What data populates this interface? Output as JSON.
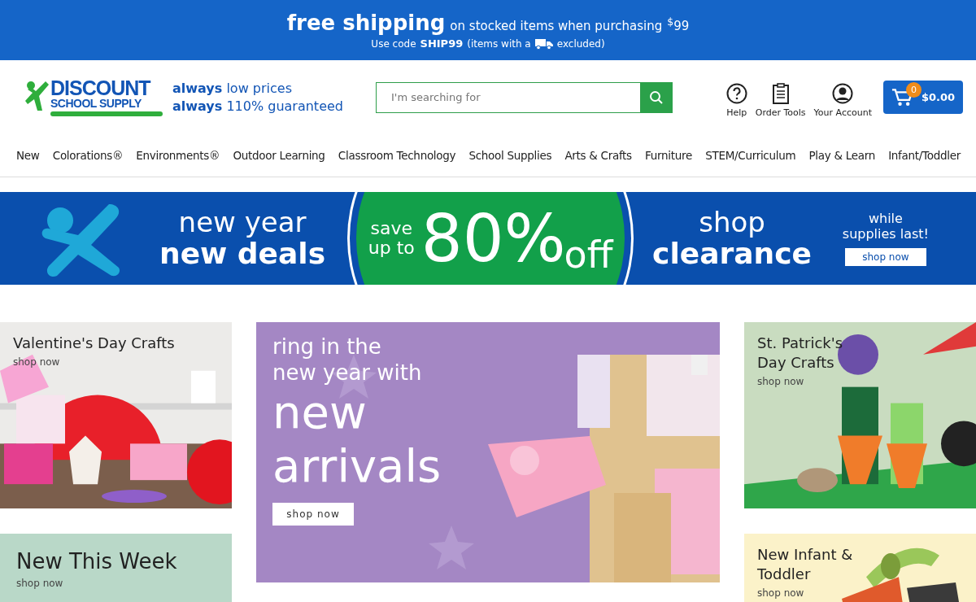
{
  "promo_bar": {
    "headline": "free shipping",
    "detail": "on stocked items when purchasing",
    "amount": "$^{$}$99",
    "code_prefix": "Use code",
    "code": "SHIP99",
    "note_before": "(items with a",
    "note_after": "excluded)"
  },
  "header": {
    "logo_top": "DISCOUNT",
    "logo_bottom": "SCHOOL SUPPLY",
    "tagline_1": "**always** low prices",
    "tagline_2": "**always** 110% guaranteed",
    "search": {
      "placeholder": "I'm searching for"
    },
    "tools": [
      {
        "kind": "help",
        "label": "Help"
      },
      {
        "kind": "order",
        "label": "Order Tools"
      },
      {
        "kind": "account",
        "label": "Your Account"
      }
    ],
    "cart": {
      "count": "0",
      "total": "$0.00"
    }
  },
  "nav": [
    "New",
    "Colorations®",
    "Environments®",
    "Outdoor Learning",
    "Classroom Technology",
    "School Supplies",
    "Arts & Crafts",
    "Furniture",
    "STEM/Curriculum",
    "Play & Learn",
    "Infant/Toddler"
  ],
  "hero": {
    "line_1": "new year",
    "line_2": "new deals",
    "save_1": "save",
    "save_2": "up to",
    "percent": "80%",
    "off": "off",
    "shop_1": "shop",
    "shop_2": "clearance",
    "note": "while supplies last!",
    "button": "shop now"
  },
  "tiles": [
    {
      "title": "Valentine's Day Crafts",
      "link": "shop now",
      "kind": "valentine"
    },
    {
      "title": "New This Week",
      "link": "shop now",
      "kind": "plain"
    },
    {
      "title_1": "ring in the",
      "title_2": "new year with",
      "big_1": "new",
      "big_2": "arrivals",
      "button": "shop now",
      "kind": "feature"
    },
    {
      "title": "St. Patrick's Day Crafts",
      "link": "shop now",
      "kind": "patrick"
    },
    {
      "title": "New Infant & Toddler",
      "link": "shop now",
      "kind": "infant"
    }
  ]
}
